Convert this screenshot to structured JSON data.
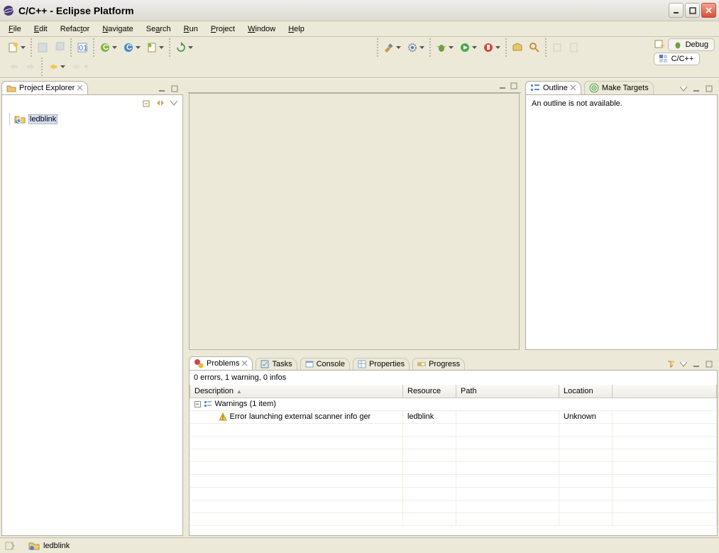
{
  "window": {
    "title": "C/C++ - Eclipse Platform"
  },
  "menu": [
    "File",
    "Edit",
    "Refactor",
    "Navigate",
    "Search",
    "Run",
    "Project",
    "Window",
    "Help"
  ],
  "perspectives": {
    "debug": "Debug",
    "ccpp": "C/C++"
  },
  "project_explorer": {
    "title": "Project Explorer",
    "items": [
      {
        "label": "ledblink"
      }
    ]
  },
  "outline": {
    "title": "Outline",
    "make_targets": "Make Targets",
    "message": "An outline is not available."
  },
  "problems": {
    "tabs": {
      "problems": "Problems",
      "tasks": "Tasks",
      "console": "Console",
      "properties": "Properties",
      "progress": "Progress"
    },
    "summary": "0 errors, 1 warning, 0 infos",
    "columns": {
      "description": "Description",
      "resource": "Resource",
      "path": "Path",
      "location": "Location"
    },
    "group": "Warnings (1 item)",
    "rows": [
      {
        "description": "Error launching external scanner info ger",
        "resource": "ledblink",
        "path": "",
        "location": "Unknown"
      }
    ]
  },
  "status": {
    "project": "ledblink"
  }
}
